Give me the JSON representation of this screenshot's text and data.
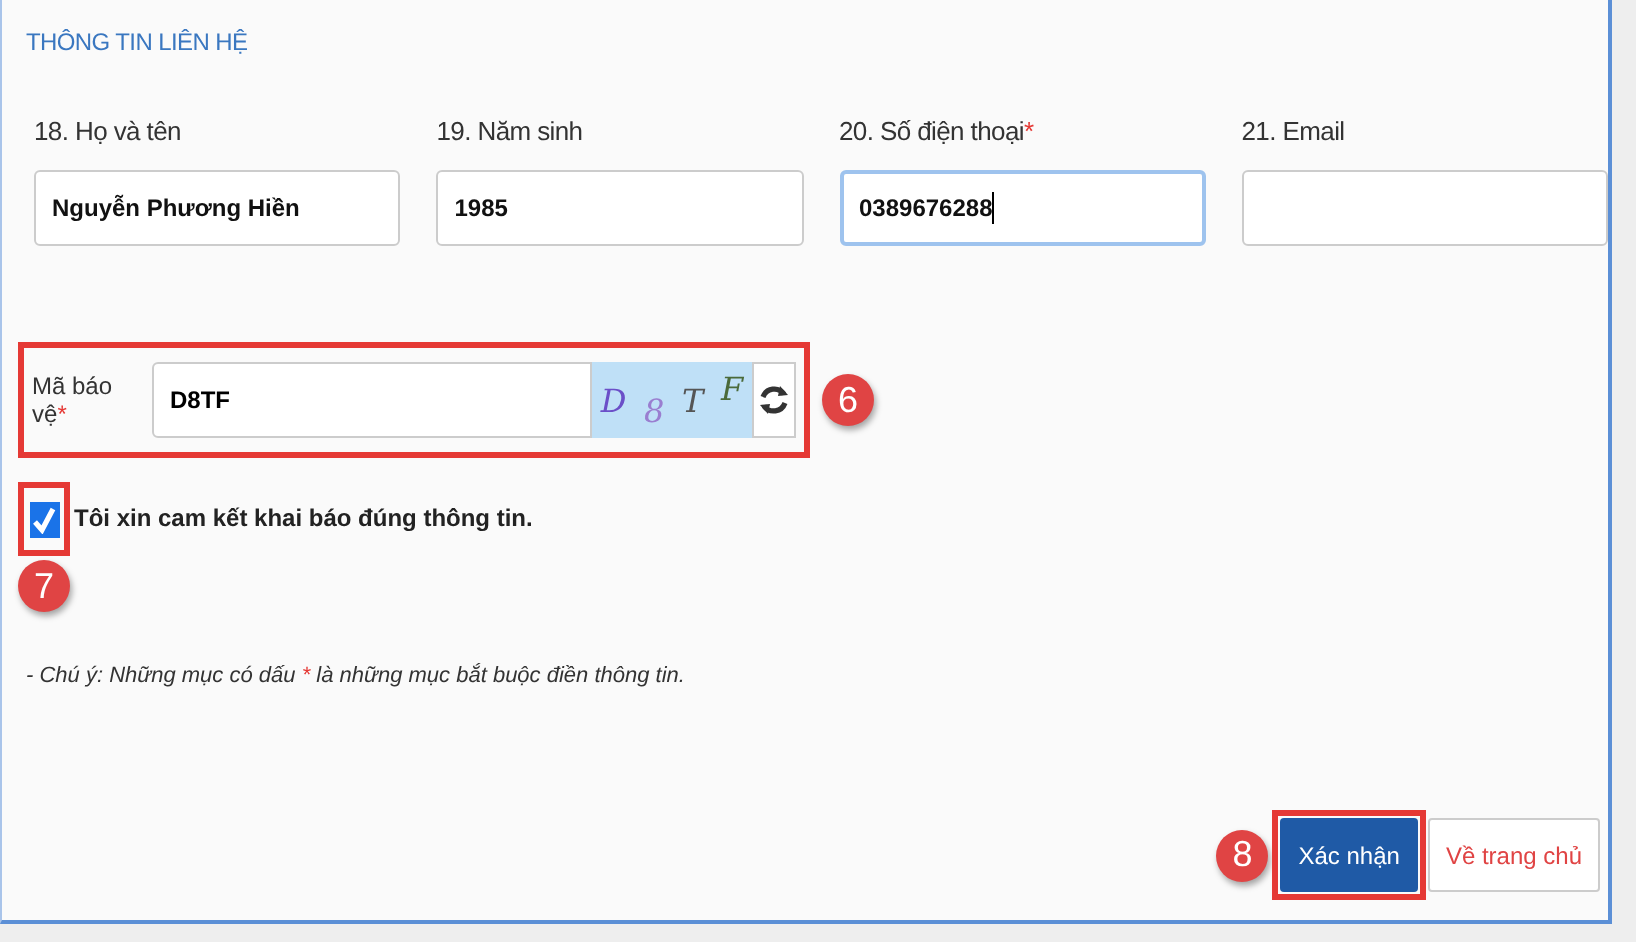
{
  "section_title": "THÔNG TIN LIÊN HỆ",
  "fields": [
    {
      "label": "18. Họ và tên",
      "value": "Nguyễn Phương Hiền",
      "focused": false
    },
    {
      "label": "19. Năm sinh",
      "value": "1985",
      "focused": false
    },
    {
      "label": "20. Số điện thoại",
      "required_mark": "*",
      "value": "0389676288",
      "focused": true
    },
    {
      "label": "21. Email",
      "focused": false
    }
  ],
  "captcha": {
    "label": "Mã báo vệ",
    "required_mark": "*",
    "value": "D8TF",
    "characters": [
      "D",
      "8",
      "T",
      "F"
    ],
    "callout": "6"
  },
  "agreement": {
    "label": "Tôi xin cam kết khai báo đúng thông tin.",
    "checked": true,
    "callout": "7"
  },
  "note": {
    "before": "- Chú ý: Những mục có dấu ",
    "mark": "*",
    "after": " là những mục bắt buộc điền thông tin."
  },
  "buttons": [
    {
      "label": "Xác nhận",
      "kind": "primary",
      "callout": "8"
    },
    {
      "label": "Về trang chủ",
      "kind": "secondary"
    }
  ]
}
